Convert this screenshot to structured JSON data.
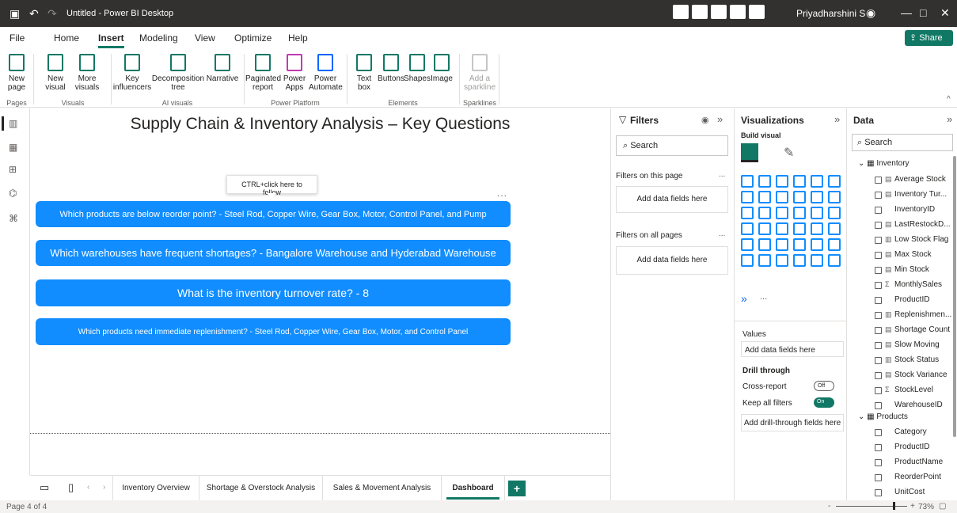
{
  "app": {
    "title": "Untitled - Power BI Desktop",
    "user": "Priyadharshini S"
  },
  "menu": {
    "items": [
      "File",
      "Home",
      "Insert",
      "Modeling",
      "View",
      "Optimize",
      "Help"
    ],
    "active": "Insert",
    "share": "Share"
  },
  "ribbon": {
    "buttons": [
      {
        "label": "New page",
        "group": "Pages"
      },
      {
        "label": "New visual",
        "group": "Visuals"
      },
      {
        "label": "More visuals",
        "group": "Visuals"
      },
      {
        "label": "Key influencers",
        "group": "AI visuals"
      },
      {
        "label": "Decomposition tree",
        "group": "AI visuals"
      },
      {
        "label": "Narrative",
        "group": "AI visuals"
      },
      {
        "label": "Paginated report",
        "group": "Power Platform"
      },
      {
        "label": "Power Apps",
        "group": "Power Platform"
      },
      {
        "label": "Power Automate",
        "group": "Power Platform"
      },
      {
        "label": "Text box",
        "group": "Elements"
      },
      {
        "label": "Buttons",
        "group": "Elements"
      },
      {
        "label": "Shapes",
        "group": "Elements"
      },
      {
        "label": "Image",
        "group": "Elements"
      },
      {
        "label": "Add a sparkline",
        "group": "Sparklines"
      }
    ],
    "groups": [
      "Pages",
      "Visuals",
      "AI visuals",
      "Power Platform",
      "Elements",
      "Sparklines"
    ]
  },
  "canvas": {
    "title": "Supply Chain & Inventory Analysis – Key Questions",
    "tooltip": "CTRL+click here to follow",
    "more": "...",
    "questions": [
      "Which products are below reorder point? - Steel Rod, Copper Wire, Gear Box, Motor, Control Panel, and Pump",
      "Which warehouses have frequent shortages? - Bangalore Warehouse and Hyderabad Warehouse",
      "What is the inventory turnover rate? - 8",
      "Which products need immediate replenishment? - Steel Rod, Copper Wire, Gear Box, Motor, and Control Panel"
    ]
  },
  "tabs": [
    "Inventory Overview",
    "Shortage & Overstock Analysis",
    "Sales & Movement Analysis",
    "Dashboard"
  ],
  "active_tab": "Dashboard",
  "status": {
    "page": "Page 4 of 4",
    "zoom": "73%"
  },
  "filters": {
    "title": "Filters",
    "search": "Search",
    "on_page": "Filters on this page",
    "on_all": "Filters on all pages",
    "add": "Add data fields here",
    "more": "..."
  },
  "viz": {
    "title": "Visualizations",
    "build": "Build visual",
    "values": "Values",
    "add": "Add data fields here",
    "drill": "Drill through",
    "cross": "Cross-report",
    "cross_state": "Off",
    "keep": "Keep all filters",
    "keep_state": "On",
    "add_drill": "Add drill-through fields here",
    "more": "..."
  },
  "data": {
    "title": "Data",
    "search": "Search",
    "tables": [
      {
        "name": "Inventory",
        "fields": [
          {
            "name": "Average Stock",
            "icon": "calc"
          },
          {
            "name": "Inventory Tur...",
            "icon": "calc"
          },
          {
            "name": "InventoryID",
            "icon": ""
          },
          {
            "name": "LastRestockD...",
            "icon": "date"
          },
          {
            "name": "Low Stock Flag",
            "icon": "col"
          },
          {
            "name": "Max Stock",
            "icon": "calc"
          },
          {
            "name": "Min Stock",
            "icon": "calc"
          },
          {
            "name": "MonthlySales",
            "icon": "sigma"
          },
          {
            "name": "ProductID",
            "icon": ""
          },
          {
            "name": "Replenishmen...",
            "icon": "col"
          },
          {
            "name": "Shortage Count",
            "icon": "calc"
          },
          {
            "name": "Slow Moving",
            "icon": "calc"
          },
          {
            "name": "Stock Status",
            "icon": "col"
          },
          {
            "name": "Stock Variance",
            "icon": "calc"
          },
          {
            "name": "StockLevel",
            "icon": "sigma"
          },
          {
            "name": "WarehouseID",
            "icon": ""
          }
        ]
      },
      {
        "name": "Products",
        "fields": [
          {
            "name": "Category",
            "icon": ""
          },
          {
            "name": "ProductID",
            "icon": ""
          },
          {
            "name": "ProductName",
            "icon": ""
          },
          {
            "name": "ReorderPoint",
            "icon": ""
          },
          {
            "name": "UnitCost",
            "icon": ""
          }
        ]
      }
    ]
  }
}
